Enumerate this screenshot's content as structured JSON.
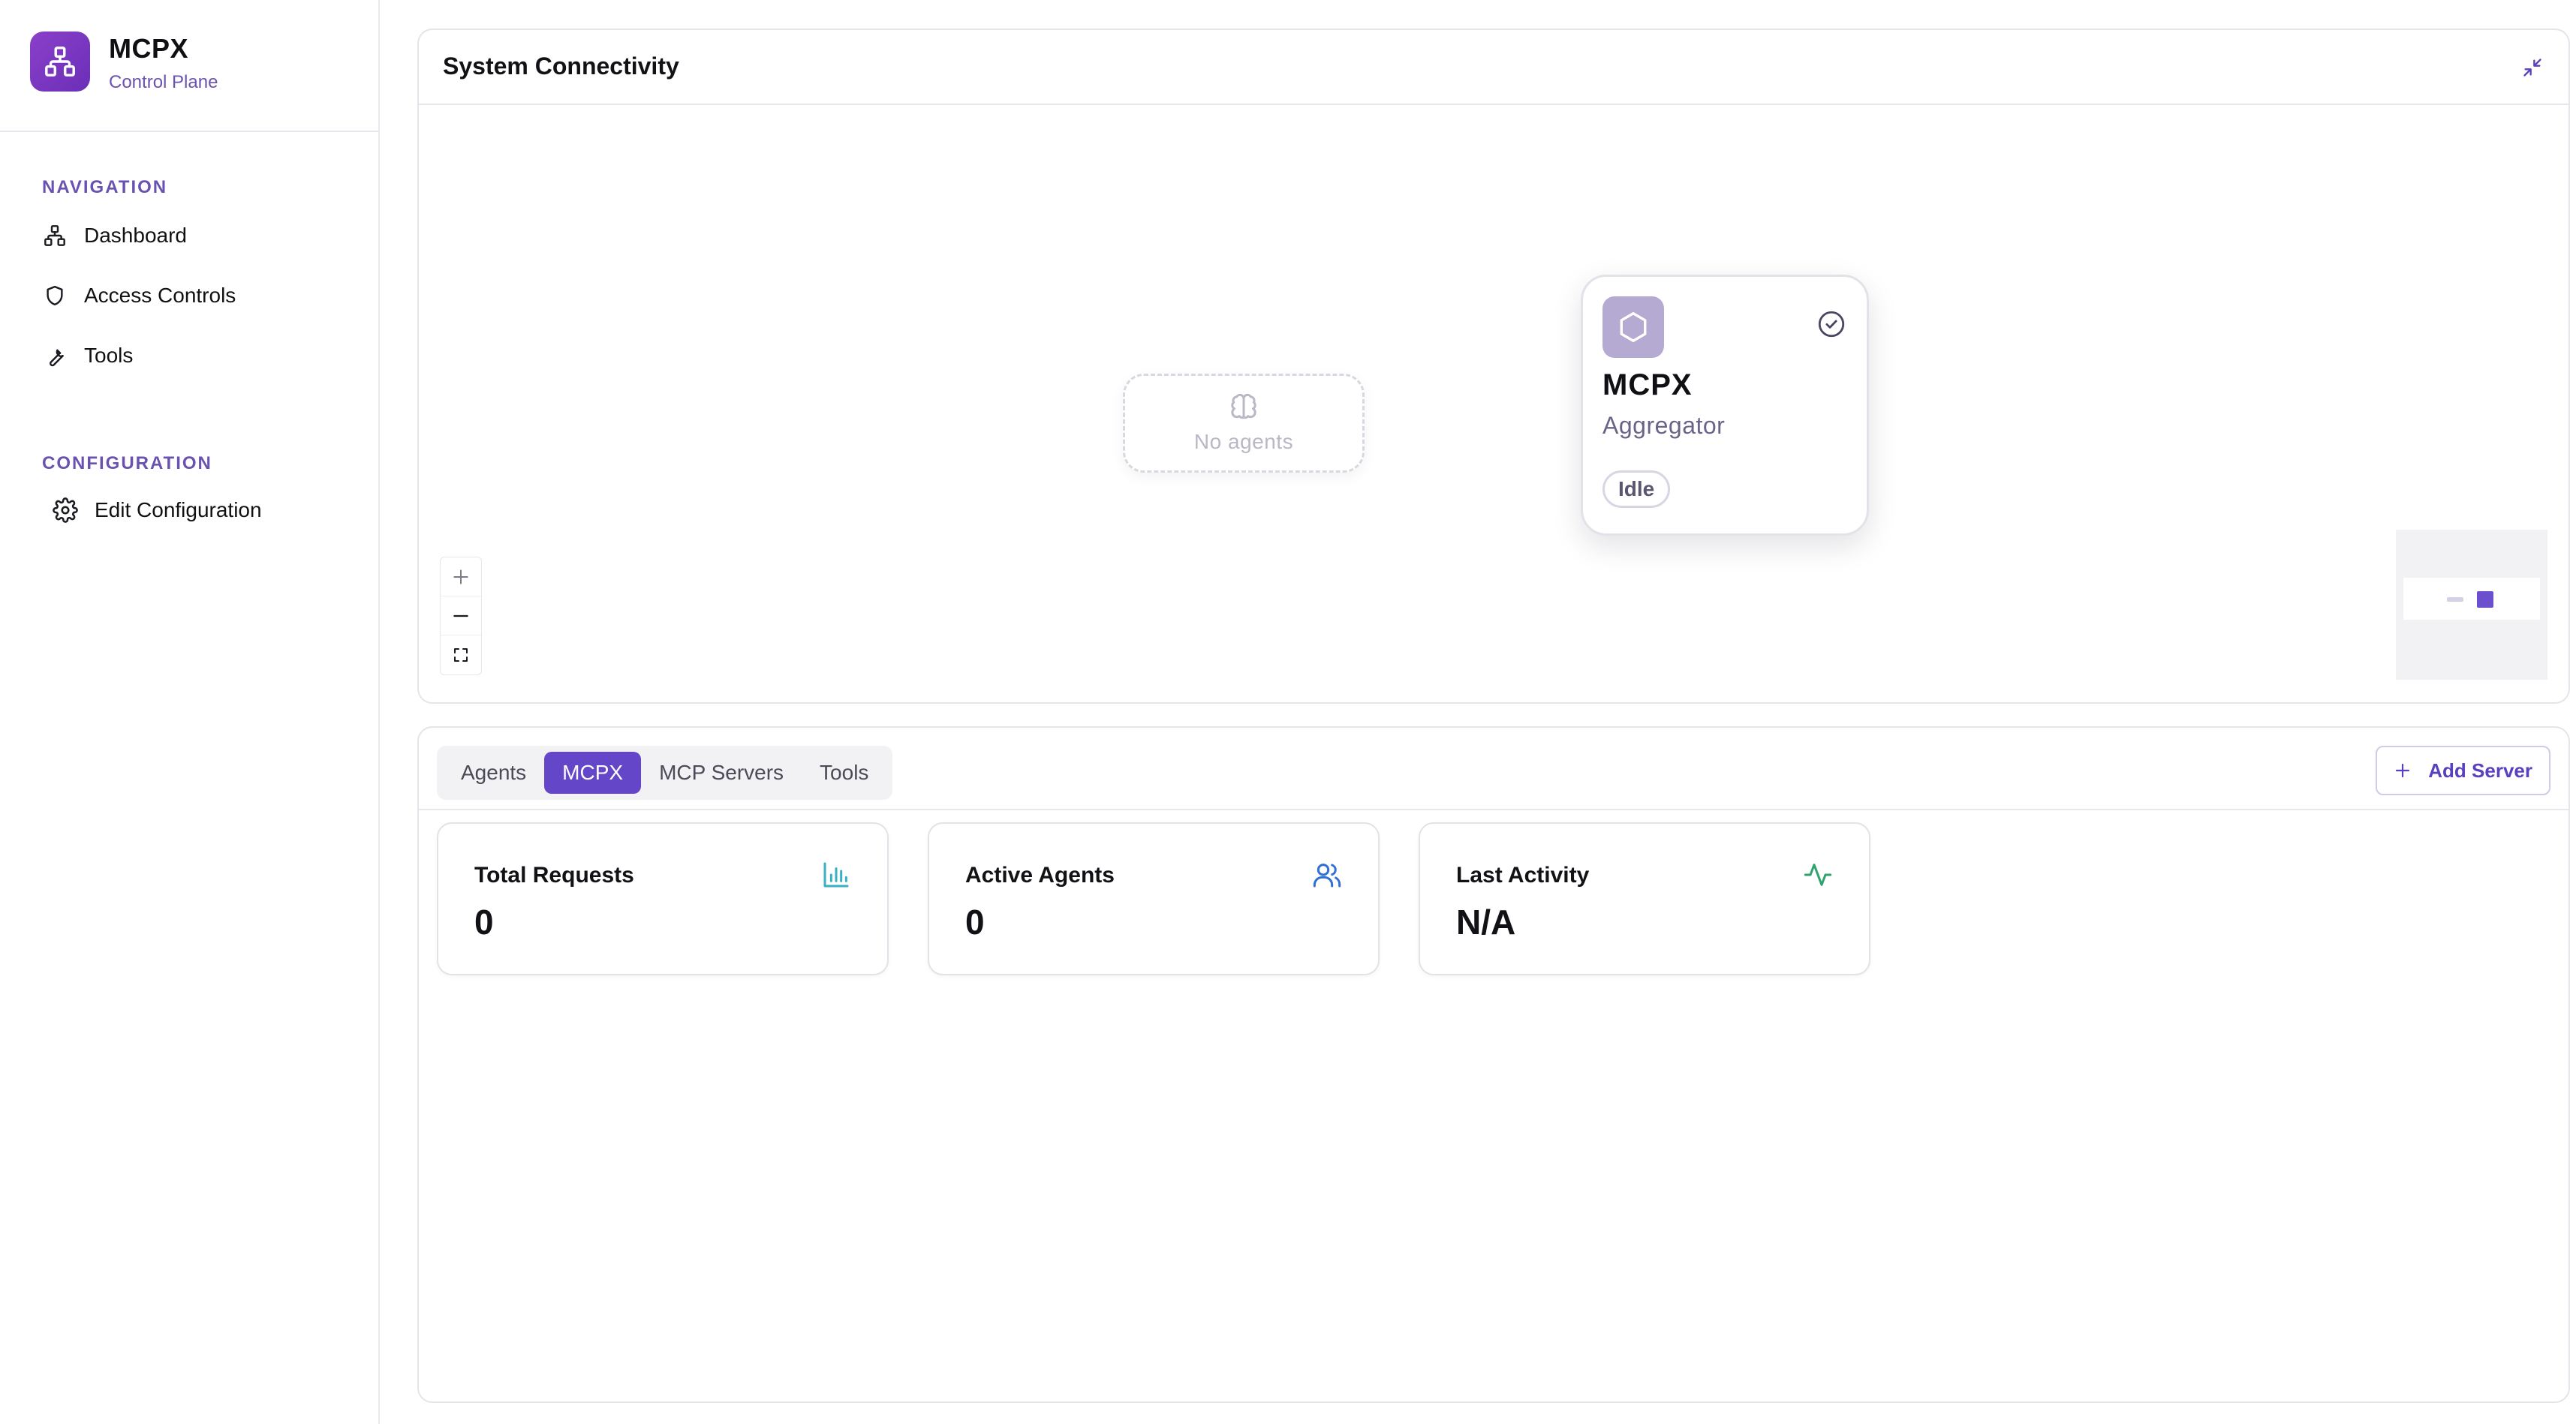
{
  "brand": {
    "title": "MCPX",
    "subtitle": "Control Plane"
  },
  "sidebar": {
    "sections": [
      {
        "heading": "NAVIGATION",
        "items": [
          {
            "label": "Dashboard",
            "icon": "network-icon"
          },
          {
            "label": "Access Controls",
            "icon": "shield-icon"
          },
          {
            "label": "Tools",
            "icon": "wrench-icon"
          }
        ]
      },
      {
        "heading": "CONFIGURATION",
        "items": [
          {
            "label": "Edit Configuration",
            "icon": "gear-icon"
          }
        ]
      }
    ]
  },
  "connectivity": {
    "title": "System Connectivity",
    "no_agents_label": "No agents",
    "node": {
      "title": "MCPX",
      "subtitle": "Aggregator",
      "status": "Idle"
    }
  },
  "details": {
    "tabs": [
      {
        "label": "Agents",
        "active": false
      },
      {
        "label": "MCPX",
        "active": true
      },
      {
        "label": "MCP Servers",
        "active": false
      },
      {
        "label": "Tools",
        "active": false
      }
    ],
    "add_server_label": "Add Server",
    "stats": [
      {
        "label": "Total Requests",
        "value": "0",
        "icon": "bar-chart-icon",
        "color": "#3ab0c4"
      },
      {
        "label": "Active Agents",
        "value": "0",
        "icon": "users-icon",
        "color": "#2f6fd6"
      },
      {
        "label": "Last Activity",
        "value": "N/A",
        "icon": "activity-icon",
        "color": "#2fa36b"
      }
    ]
  },
  "colors": {
    "accent": "#6446c8",
    "brand_gradient_start": "#8a3fc9",
    "brand_gradient_end": "#6b2fb8"
  }
}
